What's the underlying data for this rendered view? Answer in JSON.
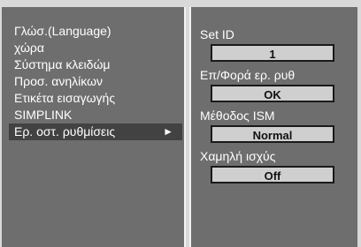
{
  "left_menu": {
    "items": [
      {
        "label": "Γλώσ.(Language)"
      },
      {
        "label": "χώρα"
      },
      {
        "label": "Σύστημα κλειδώμ"
      },
      {
        "label": "Προσ. ανηλίκων"
      },
      {
        "label": "Ετικέτα εισαγωγής"
      },
      {
        "label": "SIMPLINK"
      },
      {
        "label": "Ερ. οστ. ρυθμίσεις",
        "selected": true,
        "arrow": "►"
      }
    ]
  },
  "settings": [
    {
      "label": "Set ID",
      "value": "1"
    },
    {
      "label": "Επ/Φορά ερ. ρυθ",
      "value": "OK"
    },
    {
      "label": "Μέθοδος ISM",
      "value": "Normal"
    },
    {
      "label": "Χαμηλή ισχύς",
      "value": "Off"
    }
  ],
  "colors": {
    "panel_bg": "#6e6e6e",
    "selected_bg": "#424242",
    "value_box_bg": "#cfcfcf",
    "divider": "#f2f2f2"
  }
}
